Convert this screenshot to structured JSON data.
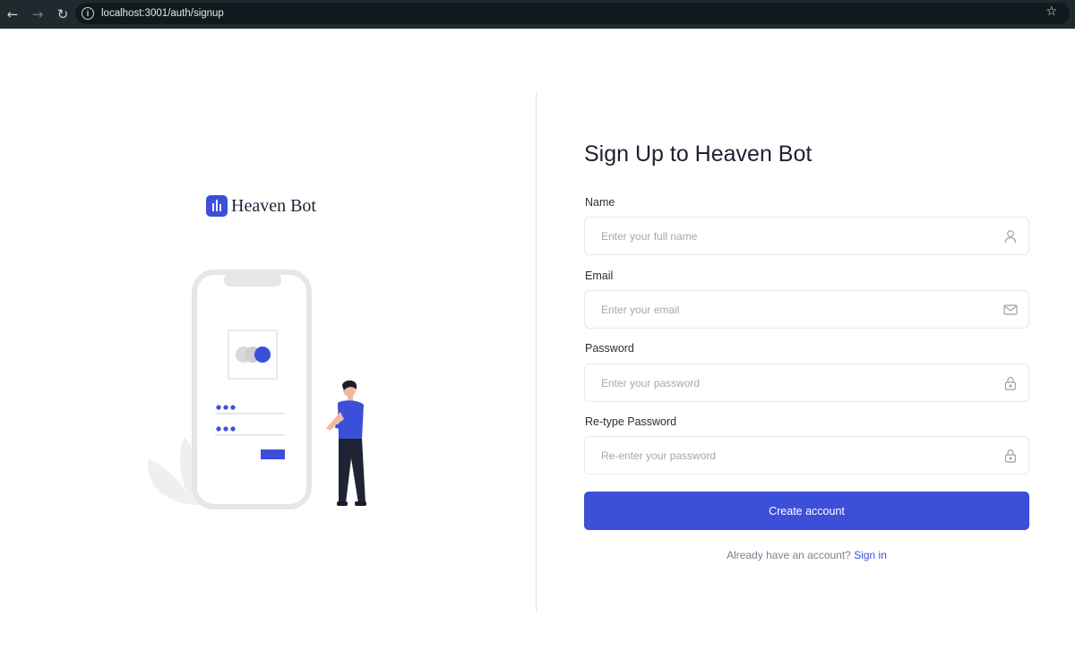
{
  "browser": {
    "url": "localhost:3001/auth/signup",
    "info_glyph": "i"
  },
  "brand": {
    "name": "Heaven Bot",
    "logo_icon": "bar-chart-icon"
  },
  "form": {
    "title": "Sign Up to Heaven Bot",
    "fields": [
      {
        "label": "Name",
        "placeholder": "Enter your full name",
        "type": "text",
        "icon": "user-icon",
        "value": ""
      },
      {
        "label": "Email",
        "placeholder": "Enter your email",
        "type": "email",
        "icon": "mail-icon",
        "value": ""
      },
      {
        "label": "Password",
        "placeholder": "Enter your password",
        "type": "password",
        "icon": "lock-icon",
        "value": ""
      },
      {
        "label": "Re-type Password",
        "placeholder": "Re-enter your password",
        "type": "password",
        "icon": "lock-icon",
        "value": ""
      }
    ],
    "submit_label": "Create account",
    "signin_prompt": "Already have an account?",
    "signin_link": "Sign in"
  },
  "colors": {
    "primary": "#3b4fd8",
    "chrome": "#1f2a2f",
    "text_dark": "#1d2133",
    "border": "#e6e8ee"
  }
}
